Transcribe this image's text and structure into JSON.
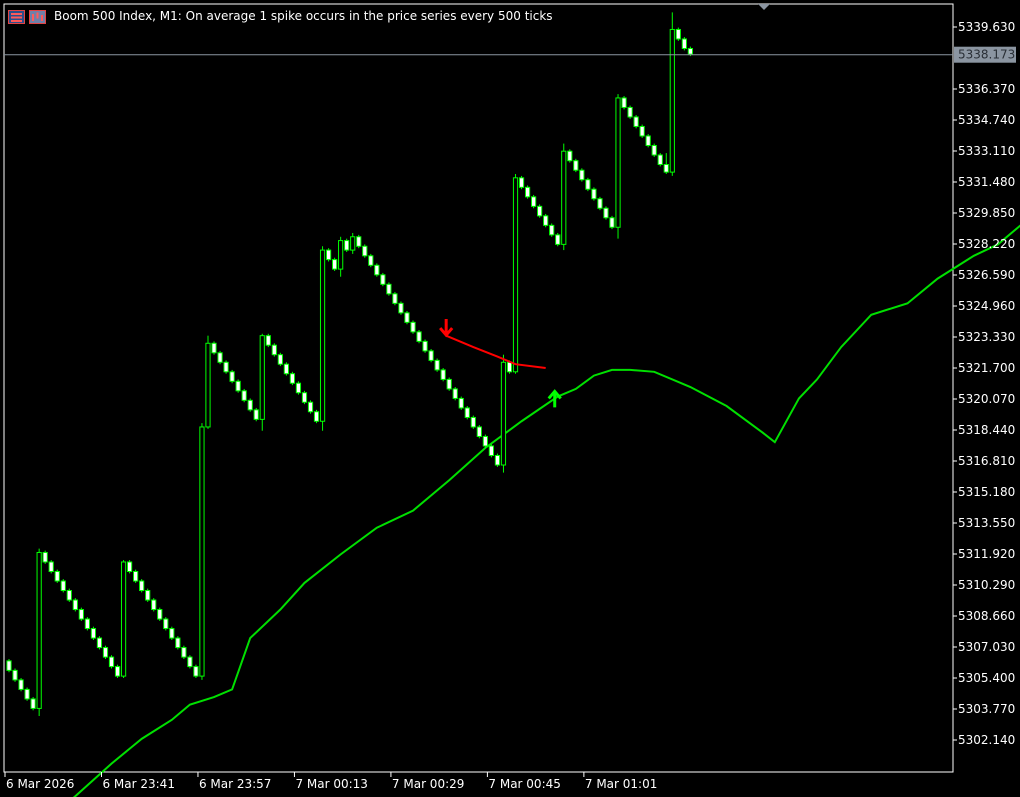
{
  "window": {
    "title": "Boom 500 Index, M1:  On average 1 spike occurs in the price series every 500 ticks"
  },
  "icons": [
    "symbol-list-icon",
    "chart-window-icon"
  ],
  "colors": {
    "background": "#000000",
    "candle": "#00ff00",
    "candle_body_up": "#000000",
    "candle_body_down": "#ffffff",
    "moving_average": "#00e000",
    "sell_signal": "#ff0000",
    "buy_signal": "#00ff00",
    "grid_axis": "#ffffff",
    "current_price_line": "#8b95a1",
    "current_price_label_bg": "#8b95a1"
  },
  "chart_data": {
    "type": "candlestick",
    "symbol": "Boom 500 Index",
    "timeframe": "M1",
    "current_price": "5338.173",
    "y_ticks": [
      "5339.630",
      "5336.370",
      "5334.740",
      "5333.110",
      "5331.480",
      "5329.850",
      "5328.220",
      "5326.590",
      "5324.960",
      "5323.330",
      "5321.700",
      "5320.070",
      "5318.440",
      "5316.810",
      "5315.180",
      "5313.550",
      "5311.920",
      "5310.290",
      "5308.660",
      "5307.030",
      "5305.400",
      "5303.770",
      "5302.140"
    ],
    "x_ticks": [
      "6 Mar 2026",
      "6 Mar 23:41",
      "6 Mar 23:57",
      "7 Mar 00:13",
      "7 Mar 00:29",
      "7 Mar 00:45",
      "7 Mar 01:01"
    ],
    "ylim": [
      5301.25,
      5340.5
    ],
    "candles": [
      {
        "o": 5306.3,
        "h": 5306.4,
        "l": 5305.7,
        "c": 5305.8
      },
      {
        "o": 5305.8,
        "h": 5305.9,
        "l": 5305.2,
        "c": 5305.3
      },
      {
        "o": 5305.3,
        "h": 5305.4,
        "l": 5304.7,
        "c": 5304.8
      },
      {
        "o": 5304.8,
        "h": 5304.9,
        "l": 5304.2,
        "c": 5304.3
      },
      {
        "o": 5304.3,
        "h": 5304.4,
        "l": 5303.7,
        "c": 5303.8
      },
      {
        "o": 5303.8,
        "h": 5312.2,
        "l": 5303.4,
        "c": 5312.0
      },
      {
        "o": 5312.0,
        "h": 5312.1,
        "l": 5311.4,
        "c": 5311.5
      },
      {
        "o": 5311.5,
        "h": 5311.6,
        "l": 5310.9,
        "c": 5311.0
      },
      {
        "o": 5311.0,
        "h": 5311.1,
        "l": 5310.4,
        "c": 5310.5
      },
      {
        "o": 5310.5,
        "h": 5310.6,
        "l": 5309.9,
        "c": 5310.0
      },
      {
        "o": 5310.0,
        "h": 5310.1,
        "l": 5309.4,
        "c": 5309.5
      },
      {
        "o": 5309.5,
        "h": 5309.6,
        "l": 5308.9,
        "c": 5309.0
      },
      {
        "o": 5309.0,
        "h": 5309.1,
        "l": 5308.4,
        "c": 5308.5
      },
      {
        "o": 5308.5,
        "h": 5308.6,
        "l": 5307.9,
        "c": 5308.0
      },
      {
        "o": 5308.0,
        "h": 5308.1,
        "l": 5307.4,
        "c": 5307.5
      },
      {
        "o": 5307.5,
        "h": 5307.6,
        "l": 5306.9,
        "c": 5307.0
      },
      {
        "o": 5307.0,
        "h": 5307.1,
        "l": 5306.4,
        "c": 5306.5
      },
      {
        "o": 5306.5,
        "h": 5306.6,
        "l": 5305.9,
        "c": 5306.0
      },
      {
        "o": 5306.0,
        "h": 5306.1,
        "l": 5305.4,
        "c": 5305.5
      },
      {
        "o": 5305.5,
        "h": 5311.6,
        "l": 5305.4,
        "c": 5311.5
      },
      {
        "o": 5311.5,
        "h": 5311.6,
        "l": 5310.9,
        "c": 5311.0
      },
      {
        "o": 5311.0,
        "h": 5311.1,
        "l": 5310.4,
        "c": 5310.5
      },
      {
        "o": 5310.5,
        "h": 5310.6,
        "l": 5309.9,
        "c": 5310.0
      },
      {
        "o": 5310.0,
        "h": 5310.1,
        "l": 5309.4,
        "c": 5309.5
      },
      {
        "o": 5309.5,
        "h": 5309.6,
        "l": 5308.9,
        "c": 5309.0
      },
      {
        "o": 5309.0,
        "h": 5309.1,
        "l": 5308.4,
        "c": 5308.5
      },
      {
        "o": 5308.5,
        "h": 5308.6,
        "l": 5307.9,
        "c": 5308.0
      },
      {
        "o": 5308.0,
        "h": 5308.1,
        "l": 5307.4,
        "c": 5307.5
      },
      {
        "o": 5307.5,
        "h": 5307.6,
        "l": 5306.9,
        "c": 5307.0
      },
      {
        "o": 5307.0,
        "h": 5307.1,
        "l": 5306.4,
        "c": 5306.5
      },
      {
        "o": 5306.5,
        "h": 5306.6,
        "l": 5305.9,
        "c": 5306.0
      },
      {
        "o": 5306.0,
        "h": 5306.1,
        "l": 5305.4,
        "c": 5305.5
      },
      {
        "o": 5305.5,
        "h": 5318.8,
        "l": 5305.3,
        "c": 5318.6
      },
      {
        "o": 5318.6,
        "h": 5323.4,
        "l": 5318.5,
        "c": 5323.0
      },
      {
        "o": 5323.0,
        "h": 5323.1,
        "l": 5322.4,
        "c": 5322.5
      },
      {
        "o": 5322.5,
        "h": 5322.6,
        "l": 5321.9,
        "c": 5322.0
      },
      {
        "o": 5322.0,
        "h": 5322.1,
        "l": 5321.4,
        "c": 5321.5
      },
      {
        "o": 5321.5,
        "h": 5321.6,
        "l": 5320.9,
        "c": 5321.0
      },
      {
        "o": 5321.0,
        "h": 5321.1,
        "l": 5320.4,
        "c": 5320.5
      },
      {
        "o": 5320.5,
        "h": 5320.6,
        "l": 5319.9,
        "c": 5320.0
      },
      {
        "o": 5320.0,
        "h": 5320.1,
        "l": 5319.4,
        "c": 5319.5
      },
      {
        "o": 5319.5,
        "h": 5319.6,
        "l": 5318.9,
        "c": 5319.0
      },
      {
        "o": 5319.0,
        "h": 5323.5,
        "l": 5318.4,
        "c": 5323.4
      },
      {
        "o": 5323.4,
        "h": 5323.5,
        "l": 5322.8,
        "c": 5322.9
      },
      {
        "o": 5322.9,
        "h": 5323.0,
        "l": 5322.3,
        "c": 5322.4
      },
      {
        "o": 5322.4,
        "h": 5322.5,
        "l": 5321.8,
        "c": 5321.9
      },
      {
        "o": 5321.9,
        "h": 5322.0,
        "l": 5321.3,
        "c": 5321.4
      },
      {
        "o": 5321.4,
        "h": 5321.5,
        "l": 5320.8,
        "c": 5320.9
      },
      {
        "o": 5320.9,
        "h": 5321.0,
        "l": 5320.3,
        "c": 5320.4
      },
      {
        "o": 5320.4,
        "h": 5320.5,
        "l": 5319.8,
        "c": 5319.9
      },
      {
        "o": 5319.9,
        "h": 5320.0,
        "l": 5319.3,
        "c": 5319.4
      },
      {
        "o": 5319.4,
        "h": 5319.5,
        "l": 5318.8,
        "c": 5318.9
      },
      {
        "o": 5318.9,
        "h": 5328.1,
        "l": 5318.4,
        "c": 5327.9
      },
      {
        "o": 5327.9,
        "h": 5328.0,
        "l": 5327.3,
        "c": 5327.4
      },
      {
        "o": 5327.4,
        "h": 5327.5,
        "l": 5326.8,
        "c": 5326.9
      },
      {
        "o": 5326.9,
        "h": 5328.6,
        "l": 5326.5,
        "c": 5328.4
      },
      {
        "o": 5328.4,
        "h": 5328.5,
        "l": 5327.8,
        "c": 5327.9
      },
      {
        "o": 5327.9,
        "h": 5328.8,
        "l": 5327.7,
        "c": 5328.6
      },
      {
        "o": 5328.6,
        "h": 5328.7,
        "l": 5328.0,
        "c": 5328.1
      },
      {
        "o": 5328.1,
        "h": 5328.2,
        "l": 5327.5,
        "c": 5327.6
      },
      {
        "o": 5327.6,
        "h": 5327.7,
        "l": 5327.0,
        "c": 5327.1
      },
      {
        "o": 5327.1,
        "h": 5327.2,
        "l": 5326.5,
        "c": 5326.6
      },
      {
        "o": 5326.6,
        "h": 5326.7,
        "l": 5326.0,
        "c": 5326.1
      },
      {
        "o": 5326.1,
        "h": 5326.2,
        "l": 5325.5,
        "c": 5325.6
      },
      {
        "o": 5325.6,
        "h": 5325.7,
        "l": 5325.0,
        "c": 5325.1
      },
      {
        "o": 5325.1,
        "h": 5325.2,
        "l": 5324.5,
        "c": 5324.6
      },
      {
        "o": 5324.6,
        "h": 5324.7,
        "l": 5324.0,
        "c": 5324.1
      },
      {
        "o": 5324.1,
        "h": 5324.2,
        "l": 5323.5,
        "c": 5323.6
      },
      {
        "o": 5323.6,
        "h": 5323.7,
        "l": 5323.0,
        "c": 5323.1
      },
      {
        "o": 5323.1,
        "h": 5323.2,
        "l": 5322.5,
        "c": 5322.6
      },
      {
        "o": 5322.6,
        "h": 5322.7,
        "l": 5322.0,
        "c": 5322.1
      },
      {
        "o": 5322.1,
        "h": 5322.2,
        "l": 5321.5,
        "c": 5321.6
      },
      {
        "o": 5321.6,
        "h": 5321.7,
        "l": 5321.0,
        "c": 5321.1
      },
      {
        "o": 5321.1,
        "h": 5321.2,
        "l": 5320.5,
        "c": 5320.6
      },
      {
        "o": 5320.6,
        "h": 5320.7,
        "l": 5320.0,
        "c": 5320.1
      },
      {
        "o": 5320.1,
        "h": 5320.2,
        "l": 5319.5,
        "c": 5319.6
      },
      {
        "o": 5319.6,
        "h": 5319.7,
        "l": 5319.0,
        "c": 5319.1
      },
      {
        "o": 5319.1,
        "h": 5319.2,
        "l": 5318.5,
        "c": 5318.6
      },
      {
        "o": 5318.6,
        "h": 5318.7,
        "l": 5318.0,
        "c": 5318.1
      },
      {
        "o": 5318.1,
        "h": 5318.2,
        "l": 5317.5,
        "c": 5317.6
      },
      {
        "o": 5317.6,
        "h": 5317.7,
        "l": 5317.0,
        "c": 5317.1
      },
      {
        "o": 5317.1,
        "h": 5317.2,
        "l": 5316.5,
        "c": 5316.6
      },
      {
        "o": 5316.6,
        "h": 5322.4,
        "l": 5316.2,
        "c": 5322.0
      },
      {
        "o": 5322.0,
        "h": 5322.1,
        "l": 5321.4,
        "c": 5321.5
      },
      {
        "o": 5321.5,
        "h": 5331.9,
        "l": 5321.4,
        "c": 5331.7
      },
      {
        "o": 5331.7,
        "h": 5331.8,
        "l": 5331.1,
        "c": 5331.2
      },
      {
        "o": 5331.2,
        "h": 5331.3,
        "l": 5330.6,
        "c": 5330.7
      },
      {
        "o": 5330.7,
        "h": 5330.8,
        "l": 5330.1,
        "c": 5330.2
      },
      {
        "o": 5330.2,
        "h": 5330.3,
        "l": 5329.6,
        "c": 5329.7
      },
      {
        "o": 5329.7,
        "h": 5329.8,
        "l": 5329.1,
        "c": 5329.2
      },
      {
        "o": 5329.2,
        "h": 5329.3,
        "l": 5328.6,
        "c": 5328.7
      },
      {
        "o": 5328.7,
        "h": 5328.8,
        "l": 5328.1,
        "c": 5328.2
      },
      {
        "o": 5328.2,
        "h": 5333.5,
        "l": 5327.9,
        "c": 5333.1
      },
      {
        "o": 5333.1,
        "h": 5333.2,
        "l": 5332.5,
        "c": 5332.6
      },
      {
        "o": 5332.6,
        "h": 5332.7,
        "l": 5332.0,
        "c": 5332.1
      },
      {
        "o": 5332.1,
        "h": 5332.2,
        "l": 5331.5,
        "c": 5331.6
      },
      {
        "o": 5331.6,
        "h": 5331.7,
        "l": 5331.0,
        "c": 5331.1
      },
      {
        "o": 5331.1,
        "h": 5331.2,
        "l": 5330.5,
        "c": 5330.6
      },
      {
        "o": 5330.6,
        "h": 5330.7,
        "l": 5330.0,
        "c": 5330.1
      },
      {
        "o": 5330.1,
        "h": 5330.2,
        "l": 5329.5,
        "c": 5329.6
      },
      {
        "o": 5329.6,
        "h": 5329.7,
        "l": 5329.0,
        "c": 5329.1
      },
      {
        "o": 5329.1,
        "h": 5336.1,
        "l": 5328.5,
        "c": 5335.9
      },
      {
        "o": 5335.9,
        "h": 5336.0,
        "l": 5335.3,
        "c": 5335.4
      },
      {
        "o": 5335.4,
        "h": 5335.5,
        "l": 5334.8,
        "c": 5334.9
      },
      {
        "o": 5334.9,
        "h": 5335.0,
        "l": 5334.3,
        "c": 5334.4
      },
      {
        "o": 5334.4,
        "h": 5334.5,
        "l": 5333.8,
        "c": 5333.9
      },
      {
        "o": 5333.9,
        "h": 5334.0,
        "l": 5333.3,
        "c": 5333.4
      },
      {
        "o": 5333.4,
        "h": 5333.5,
        "l": 5332.8,
        "c": 5332.9
      },
      {
        "o": 5332.9,
        "h": 5333.0,
        "l": 5332.3,
        "c": 5332.4
      },
      {
        "o": 5332.4,
        "h": 5333.0,
        "l": 5331.9,
        "c": 5332.0
      },
      {
        "o": 5332.0,
        "h": 5340.4,
        "l": 5331.8,
        "c": 5339.5
      },
      {
        "o": 5339.5,
        "h": 5339.6,
        "l": 5338.9,
        "c": 5339.0
      },
      {
        "o": 5339.0,
        "h": 5339.1,
        "l": 5338.4,
        "c": 5338.5
      },
      {
        "o": 5338.5,
        "h": 5338.6,
        "l": 5338.1,
        "c": 5338.2
      }
    ],
    "moving_average": [
      [
        -27,
        5298.9
      ],
      [
        -20,
        5300.9
      ],
      [
        -15,
        5302.2
      ],
      [
        -10,
        5303.2
      ],
      [
        -7,
        5304.0
      ],
      [
        -3,
        5304.4
      ],
      [
        0,
        5304.8
      ],
      [
        3,
        5307.5
      ],
      [
        8,
        5309.0
      ],
      [
        12,
        5310.4
      ],
      [
        18,
        5311.9
      ],
      [
        24,
        5313.3
      ],
      [
        30,
        5314.2
      ],
      [
        36,
        5315.8
      ],
      [
        42,
        5317.5
      ],
      [
        48,
        5318.9
      ],
      [
        54,
        5320.2
      ],
      [
        57,
        5320.6
      ],
      [
        60,
        5321.3
      ],
      [
        63,
        5321.6
      ],
      [
        66,
        5321.6
      ],
      [
        70,
        5321.5
      ],
      [
        76,
        5320.7
      ],
      [
        82,
        5319.7
      ],
      [
        88,
        5318.3
      ],
      [
        90,
        5317.8
      ],
      [
        94,
        5320.1
      ],
      [
        97,
        5321.1
      ],
      [
        101,
        5322.8
      ],
      [
        106,
        5324.5
      ],
      [
        112,
        5325.1
      ],
      [
        117,
        5326.4
      ],
      [
        123,
        5327.6
      ],
      [
        127,
        5328.2
      ],
      [
        133,
        5329.8
      ]
    ],
    "signals": [
      {
        "type": "sell",
        "at": 72.5,
        "y": 5323.8
      },
      {
        "type": "buy",
        "at": 90.5,
        "y": 5320.1
      }
    ],
    "signal_line": [
      [
        72.5,
        5323.4
      ],
      [
        77,
        5322.8
      ],
      [
        81,
        5322.3
      ],
      [
        84,
        5321.9
      ],
      [
        89,
        5321.7
      ]
    ]
  }
}
